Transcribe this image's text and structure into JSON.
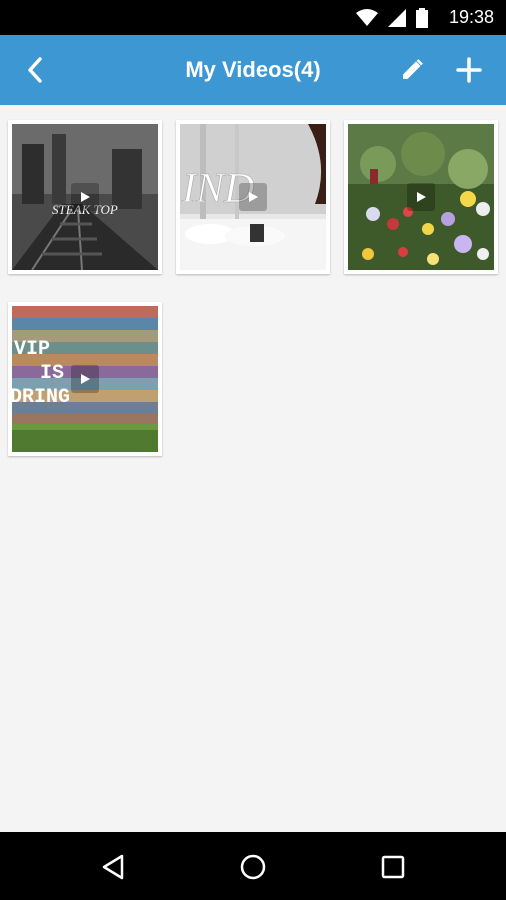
{
  "status_bar": {
    "time": "19:38",
    "icons": [
      "wifi-icon",
      "signal-icon",
      "battery-icon"
    ]
  },
  "app_bar": {
    "title": "My Videos(4)",
    "back_icon": "chevron-left-icon",
    "edit_icon": "pencil-icon",
    "add_icon": "plus-icon",
    "color": "#3c97d3"
  },
  "videos": [
    {
      "id": "video-1",
      "thumb_text": "STEAK TOP",
      "play_icon": "play-icon"
    },
    {
      "id": "video-2",
      "thumb_text": "IND",
      "play_icon": "play-icon"
    },
    {
      "id": "video-3",
      "thumb_text": "",
      "play_icon": "play-icon"
    },
    {
      "id": "video-4",
      "thumb_text": "VIP IS DRING",
      "play_icon": "play-icon"
    }
  ],
  "nav_bar": {
    "back_icon": "triangle-back-icon",
    "home_icon": "circle-home-icon",
    "recents_icon": "square-recents-icon"
  }
}
